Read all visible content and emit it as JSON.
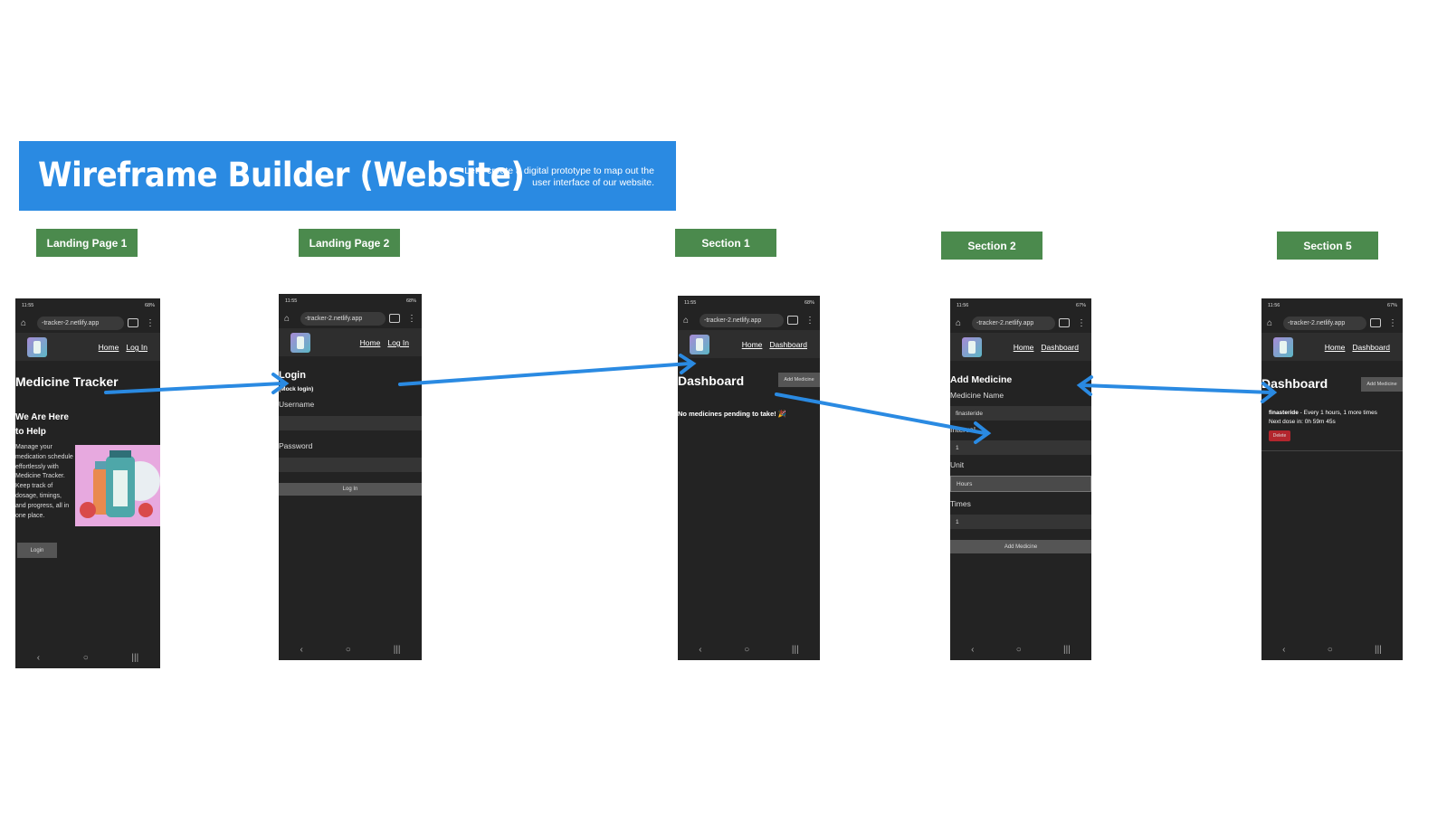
{
  "banner": {
    "title": "Wireframe Builder (Website)",
    "subtitle": "Let's create a digital prototype to map out the user interface of our website."
  },
  "tags": {
    "landing1": "Landing Page 1",
    "landing2": "Landing Page 2",
    "section1": "Section 1",
    "section2": "Section 2",
    "section5": "Section 5"
  },
  "common": {
    "url": "-tracker-2.netlify.app",
    "home_link": "Home",
    "login_link": "Log In",
    "dashboard_link": "Dashboard",
    "nav_back": "‹",
    "nav_home": "○",
    "nav_recent": "|||"
  },
  "screen1": {
    "status_time": "11:55",
    "status_battery": "68%",
    "title": "Medicine Tracker",
    "heading": "We Are Here to Help",
    "body": "Manage your medication schedule effortlessly with Medicine Tracker. Keep track of dosage, timings, and progress, all in one place.",
    "button": "Login"
  },
  "screen2": {
    "status_time": "11:55",
    "status_battery": "68%",
    "title": "Login",
    "subtitle": "(Mock login)",
    "username_label": "Username",
    "password_label": "Password",
    "button": "Log In"
  },
  "screen3": {
    "status_time": "11:55",
    "status_battery": "68%",
    "title": "Dashboard",
    "add_button": "Add Medicine",
    "empty_message": "No medicines pending to take! 🎉"
  },
  "screen4": {
    "status_time": "11:56",
    "status_battery": "67%",
    "title": "Add Medicine",
    "name_label": "Medicine Name",
    "name_value": "finasteride",
    "interval_label": "Interval",
    "interval_value": "1",
    "unit_label": "Unit",
    "unit_value": "Hours",
    "times_label": "Times",
    "times_value": "1",
    "button": "Add Medicine"
  },
  "screen5": {
    "status_time": "11:56",
    "status_battery": "67%",
    "title": "Dashboard",
    "add_button": "Add Medicine",
    "med_name": "finasteride",
    "med_detail": " - Every 1 hours, 1 more times",
    "next_dose": "Next dose in: 0h 59m 45s",
    "delete_button": "Delete"
  },
  "colors": {
    "banner_blue": "#2a8ae2",
    "tag_green": "#4b8a4d",
    "arrow_blue": "#2a8ae2",
    "phone_bg": "#232323",
    "delete_red": "#b3262d"
  }
}
